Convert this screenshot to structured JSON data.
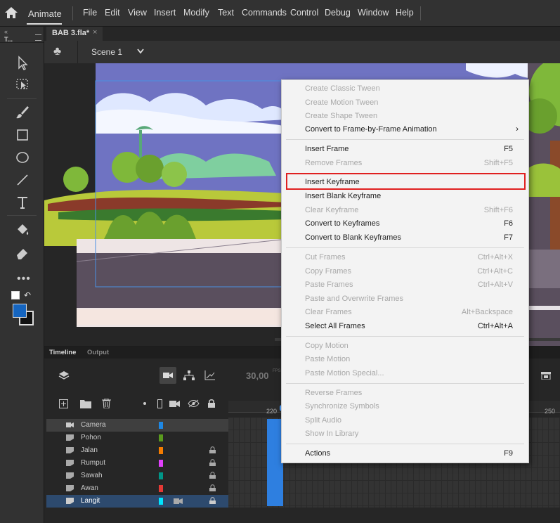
{
  "menubar": {
    "app_name": "Animate",
    "items": [
      "File",
      "Edit",
      "View",
      "Insert",
      "Modify",
      "Text",
      "Commands",
      "Control",
      "Debug",
      "Window",
      "Help"
    ]
  },
  "tools_header": "T...",
  "document": {
    "tab_title": "BAB 3.fla*",
    "scene": "Scene 1"
  },
  "timeline": {
    "tabs": [
      "Timeline",
      "Output"
    ],
    "fps": "30,00",
    "fps_unit": "FPS",
    "frame_numbers": [
      "220",
      "250"
    ],
    "layers": [
      {
        "name": "Camera",
        "color": "#1e88e5",
        "locked": false
      },
      {
        "name": "Pohon",
        "color": "#5a9a1e",
        "locked": false
      },
      {
        "name": "Jalan",
        "color": "#f57c00",
        "locked": true
      },
      {
        "name": "Rumput",
        "color": "#e040fb",
        "locked": true
      },
      {
        "name": "Sawah",
        "color": "#009688",
        "locked": true
      },
      {
        "name": "Awan",
        "color": "#e53935",
        "locked": true
      },
      {
        "name": "Langit",
        "color": "#00e5ff",
        "locked": true
      }
    ]
  },
  "context_menu": {
    "items": [
      {
        "label": "Create Classic Tween",
        "shortcut": "",
        "enabled": false
      },
      {
        "label": "Create Motion Tween",
        "shortcut": "",
        "enabled": false
      },
      {
        "label": "Create Shape Tween",
        "shortcut": "",
        "enabled": false
      },
      {
        "label": "Convert to Frame-by-Frame Animation",
        "shortcut": "",
        "enabled": true,
        "submenu": true
      },
      {
        "label": "Insert Frame",
        "shortcut": "F5",
        "enabled": true
      },
      {
        "label": "Remove Frames",
        "shortcut": "Shift+F5",
        "enabled": false
      },
      {
        "label": "Insert Keyframe",
        "shortcut": "",
        "enabled": true,
        "highlighted": true
      },
      {
        "label": "Insert Blank Keyframe",
        "shortcut": "",
        "enabled": true
      },
      {
        "label": "Clear Keyframe",
        "shortcut": "Shift+F6",
        "enabled": false
      },
      {
        "label": "Convert to Keyframes",
        "shortcut": "F6",
        "enabled": true
      },
      {
        "label": "Convert to Blank Keyframes",
        "shortcut": "F7",
        "enabled": true
      },
      {
        "label": "Cut Frames",
        "shortcut": "Ctrl+Alt+X",
        "enabled": false
      },
      {
        "label": "Copy Frames",
        "shortcut": "Ctrl+Alt+C",
        "enabled": false
      },
      {
        "label": "Paste Frames",
        "shortcut": "Ctrl+Alt+V",
        "enabled": false
      },
      {
        "label": "Paste and Overwrite Frames",
        "shortcut": "",
        "enabled": false
      },
      {
        "label": "Clear Frames",
        "shortcut": "Alt+Backspace",
        "enabled": false
      },
      {
        "label": "Select All Frames",
        "shortcut": "Ctrl+Alt+A",
        "enabled": true
      },
      {
        "label": "Copy Motion",
        "shortcut": "",
        "enabled": false
      },
      {
        "label": "Paste Motion",
        "shortcut": "",
        "enabled": false
      },
      {
        "label": "Paste Motion Special...",
        "shortcut": "",
        "enabled": false
      },
      {
        "label": "Reverse Frames",
        "shortcut": "",
        "enabled": false
      },
      {
        "label": "Synchronize Symbols",
        "shortcut": "",
        "enabled": false
      },
      {
        "label": "Split Audio",
        "shortcut": "",
        "enabled": false
      },
      {
        "label": "Show In Library",
        "shortcut": "",
        "enabled": false
      },
      {
        "label": "Actions",
        "shortcut": "F9",
        "enabled": true
      }
    ]
  },
  "colors": {
    "highlight_border": "#e02020",
    "fill_color": "#1565c0"
  }
}
